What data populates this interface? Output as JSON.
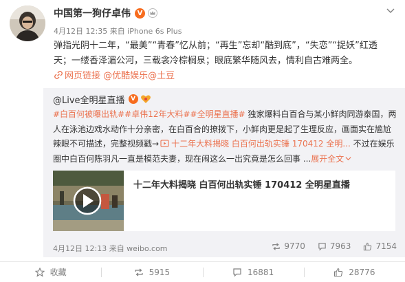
{
  "post": {
    "author": "中国第一狗仔卓伟",
    "verified_badge": "V",
    "meta": "4月12日 12:35 来自 iPhone 6s Plus",
    "text": "弹指光阴十二年，“最美”“青春”忆从前；“再生”忘却“酷到底”，“失恋”“捉妖”红透天；一缕香泽湄公河，三载衾冷棕榈泉；眼底繁华随风去，情利自古难两全。",
    "links": {
      "web_link": "网页链接",
      "mention_youku": "@优酷娱乐",
      "mention_tudou": "@土豆"
    }
  },
  "repost": {
    "author": "@Live全明星直播",
    "verified_badge": "V",
    "tags": [
      "#白百何被曝出轨#",
      "#卓伟12年大料#",
      "#全明星直播#"
    ],
    "text_1": " 独家爆料白百合与某小鲜肉同游泰国，两人在泳池边戏水动作十分亲密，在白百合的撩拨下，小鲜肉更是起了生理反应，画面实在尴尬辣眼不可描述，完整视频戳→",
    "video_link": "十二年大料揭晓 白百何出轨实锤 170412 全明...",
    "text_2": " 不过在娱乐圈中白百何陈羽凡一直是模范夫妻，现在闹这么一出究竟是怎么回事 ...",
    "expand": "展开全文",
    "video_title": "十二年大料揭晓 白百何出轨实锤 170412 全明星直播",
    "meta": "4月12日 12:13 来自 weibo.com",
    "stats": {
      "reposts": "9770",
      "comments": "7963",
      "likes": "7154"
    }
  },
  "actions": {
    "favorite": "收藏",
    "repost": "5915",
    "comment": "16881",
    "like": "28776"
  },
  "icons": {
    "avatar": "avatar-image",
    "crown": "crown-icon",
    "heart": "heart-badge-icon",
    "chevron": "chevron-down-icon",
    "link": "link-icon",
    "play": "play-icon"
  },
  "colors": {
    "accent": "#eb7350",
    "vip": "#f76c1e",
    "muted": "#808080",
    "repost_bg": "#f2f2f5"
  }
}
